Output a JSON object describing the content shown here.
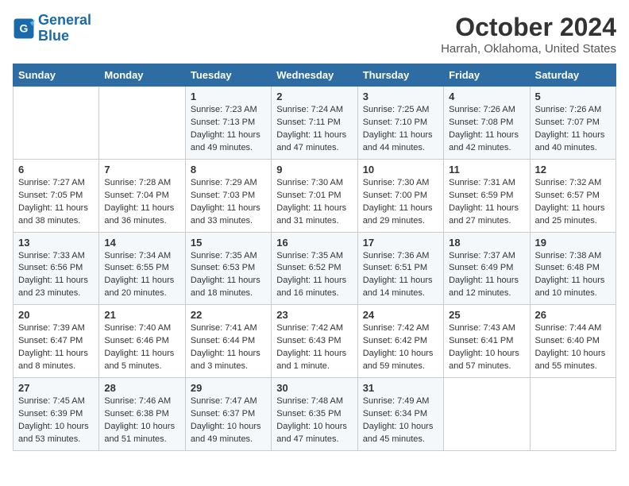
{
  "logo": {
    "line1": "General",
    "line2": "Blue"
  },
  "title": "October 2024",
  "subtitle": "Harrah, Oklahoma, United States",
  "header": {
    "days": [
      "Sunday",
      "Monday",
      "Tuesday",
      "Wednesday",
      "Thursday",
      "Friday",
      "Saturday"
    ]
  },
  "weeks": [
    [
      {
        "day": "",
        "info": ""
      },
      {
        "day": "",
        "info": ""
      },
      {
        "day": "1",
        "info": "Sunrise: 7:23 AM\nSunset: 7:13 PM\nDaylight: 11 hours and 49 minutes."
      },
      {
        "day": "2",
        "info": "Sunrise: 7:24 AM\nSunset: 7:11 PM\nDaylight: 11 hours and 47 minutes."
      },
      {
        "day": "3",
        "info": "Sunrise: 7:25 AM\nSunset: 7:10 PM\nDaylight: 11 hours and 44 minutes."
      },
      {
        "day": "4",
        "info": "Sunrise: 7:26 AM\nSunset: 7:08 PM\nDaylight: 11 hours and 42 minutes."
      },
      {
        "day": "5",
        "info": "Sunrise: 7:26 AM\nSunset: 7:07 PM\nDaylight: 11 hours and 40 minutes."
      }
    ],
    [
      {
        "day": "6",
        "info": "Sunrise: 7:27 AM\nSunset: 7:05 PM\nDaylight: 11 hours and 38 minutes."
      },
      {
        "day": "7",
        "info": "Sunrise: 7:28 AM\nSunset: 7:04 PM\nDaylight: 11 hours and 36 minutes."
      },
      {
        "day": "8",
        "info": "Sunrise: 7:29 AM\nSunset: 7:03 PM\nDaylight: 11 hours and 33 minutes."
      },
      {
        "day": "9",
        "info": "Sunrise: 7:30 AM\nSunset: 7:01 PM\nDaylight: 11 hours and 31 minutes."
      },
      {
        "day": "10",
        "info": "Sunrise: 7:30 AM\nSunset: 7:00 PM\nDaylight: 11 hours and 29 minutes."
      },
      {
        "day": "11",
        "info": "Sunrise: 7:31 AM\nSunset: 6:59 PM\nDaylight: 11 hours and 27 minutes."
      },
      {
        "day": "12",
        "info": "Sunrise: 7:32 AM\nSunset: 6:57 PM\nDaylight: 11 hours and 25 minutes."
      }
    ],
    [
      {
        "day": "13",
        "info": "Sunrise: 7:33 AM\nSunset: 6:56 PM\nDaylight: 11 hours and 23 minutes."
      },
      {
        "day": "14",
        "info": "Sunrise: 7:34 AM\nSunset: 6:55 PM\nDaylight: 11 hours and 20 minutes."
      },
      {
        "day": "15",
        "info": "Sunrise: 7:35 AM\nSunset: 6:53 PM\nDaylight: 11 hours and 18 minutes."
      },
      {
        "day": "16",
        "info": "Sunrise: 7:35 AM\nSunset: 6:52 PM\nDaylight: 11 hours and 16 minutes."
      },
      {
        "day": "17",
        "info": "Sunrise: 7:36 AM\nSunset: 6:51 PM\nDaylight: 11 hours and 14 minutes."
      },
      {
        "day": "18",
        "info": "Sunrise: 7:37 AM\nSunset: 6:49 PM\nDaylight: 11 hours and 12 minutes."
      },
      {
        "day": "19",
        "info": "Sunrise: 7:38 AM\nSunset: 6:48 PM\nDaylight: 11 hours and 10 minutes."
      }
    ],
    [
      {
        "day": "20",
        "info": "Sunrise: 7:39 AM\nSunset: 6:47 PM\nDaylight: 11 hours and 8 minutes."
      },
      {
        "day": "21",
        "info": "Sunrise: 7:40 AM\nSunset: 6:46 PM\nDaylight: 11 hours and 5 minutes."
      },
      {
        "day": "22",
        "info": "Sunrise: 7:41 AM\nSunset: 6:44 PM\nDaylight: 11 hours and 3 minutes."
      },
      {
        "day": "23",
        "info": "Sunrise: 7:42 AM\nSunset: 6:43 PM\nDaylight: 11 hours and 1 minute."
      },
      {
        "day": "24",
        "info": "Sunrise: 7:42 AM\nSunset: 6:42 PM\nDaylight: 10 hours and 59 minutes."
      },
      {
        "day": "25",
        "info": "Sunrise: 7:43 AM\nSunset: 6:41 PM\nDaylight: 10 hours and 57 minutes."
      },
      {
        "day": "26",
        "info": "Sunrise: 7:44 AM\nSunset: 6:40 PM\nDaylight: 10 hours and 55 minutes."
      }
    ],
    [
      {
        "day": "27",
        "info": "Sunrise: 7:45 AM\nSunset: 6:39 PM\nDaylight: 10 hours and 53 minutes."
      },
      {
        "day": "28",
        "info": "Sunrise: 7:46 AM\nSunset: 6:38 PM\nDaylight: 10 hours and 51 minutes."
      },
      {
        "day": "29",
        "info": "Sunrise: 7:47 AM\nSunset: 6:37 PM\nDaylight: 10 hours and 49 minutes."
      },
      {
        "day": "30",
        "info": "Sunrise: 7:48 AM\nSunset: 6:35 PM\nDaylight: 10 hours and 47 minutes."
      },
      {
        "day": "31",
        "info": "Sunrise: 7:49 AM\nSunset: 6:34 PM\nDaylight: 10 hours and 45 minutes."
      },
      {
        "day": "",
        "info": ""
      },
      {
        "day": "",
        "info": ""
      }
    ]
  ]
}
